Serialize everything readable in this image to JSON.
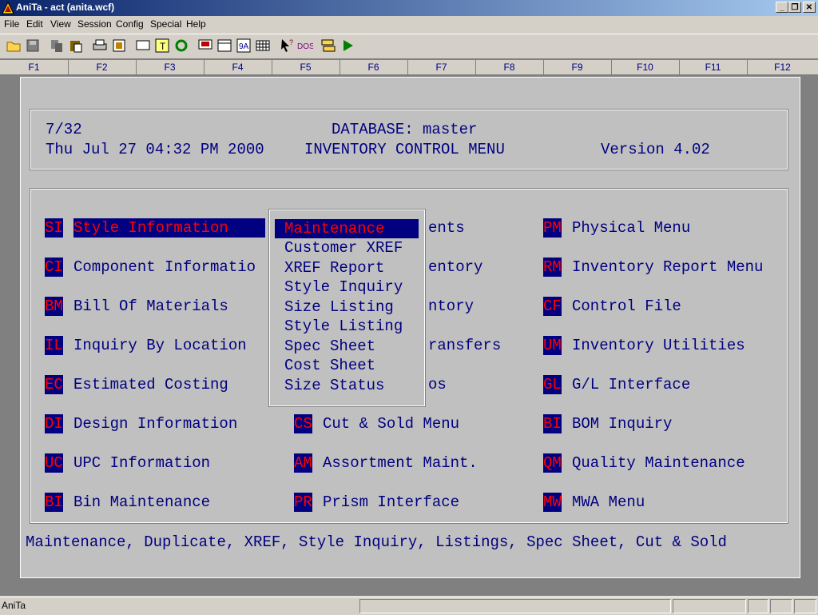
{
  "window": {
    "title": "AniTa -  act (anita.wcf)"
  },
  "window_buttons": {
    "minimize": "_",
    "maximize": "❐",
    "close": "✕"
  },
  "menu": [
    "File",
    "Edit",
    "View",
    "Session",
    "Config",
    "Special",
    "Help"
  ],
  "toolbar_icons": [
    "open-folder-icon",
    "save-icon",
    "copy-icon",
    "paste-icon",
    "print-icon",
    "print-setup-icon",
    "screen-icon",
    "screen-highlight-icon",
    "refresh-icon",
    "monitor-icon",
    "window-icon",
    "font-icon",
    "grid-icon",
    "pointer-help-icon",
    "dos-icon",
    "transfer-icon",
    "play-icon"
  ],
  "fkeys": [
    "F1",
    "F2",
    "F3",
    "F4",
    "F5",
    "F6",
    "F7",
    "F8",
    "F9",
    "F10",
    "F11",
    "F12"
  ],
  "header": {
    "page": "7/32",
    "database": "DATABASE: master",
    "datetime": "Thu Jul 27 04:32 PM 2000",
    "menu_title": "INVENTORY CONTROL MENU",
    "version": "Version 4.02"
  },
  "col1": [
    {
      "code": "SI",
      "label": "Style Information  "
    },
    {
      "code": "CI",
      "label": "Component Informatio"
    },
    {
      "code": "BM",
      "label": "Bill Of Materials"
    },
    {
      "code": "IL",
      "label": "Inquiry By Location"
    },
    {
      "code": "EC",
      "label": "Estimated Costing"
    },
    {
      "code": "DI",
      "label": "Design Information"
    },
    {
      "code": "UC",
      "label": "UPC Information"
    },
    {
      "code": "BI",
      "label": "Bin Maintenance"
    }
  ],
  "col2_partial": [
    "ents",
    "entory",
    "ntory",
    "ransfers",
    "os"
  ],
  "col2": [
    {
      "code": "CS",
      "label": "Cut & Sold Menu"
    },
    {
      "code": "AM",
      "label": "Assortment Maint."
    },
    {
      "code": "PR",
      "label": "Prism Interface"
    }
  ],
  "col3": [
    {
      "code": "PM",
      "label": "Physical Menu"
    },
    {
      "code": "RM",
      "label": "Inventory Report Menu"
    },
    {
      "code": "CF",
      "label": "Control File"
    },
    {
      "code": "UM",
      "label": "Inventory Utilities"
    },
    {
      "code": "GL",
      "label": "G/L Interface"
    },
    {
      "code": "BI",
      "label": "BOM Inquiry"
    },
    {
      "code": "QM",
      "label": "Quality Maintenance"
    },
    {
      "code": "MW",
      "label": "MWA Menu"
    }
  ],
  "popup": [
    "Maintenance",
    "Customer XREF",
    "XREF Report",
    "Style Inquiry",
    "Size Listing",
    "Style Listing",
    "Spec Sheet",
    "Cost Sheet",
    "Size Status"
  ],
  "hint": "Maintenance, Duplicate, XREF, Style Inquiry, Listings, Spec Sheet, Cut & Sold",
  "status": {
    "left": "AniTa"
  }
}
